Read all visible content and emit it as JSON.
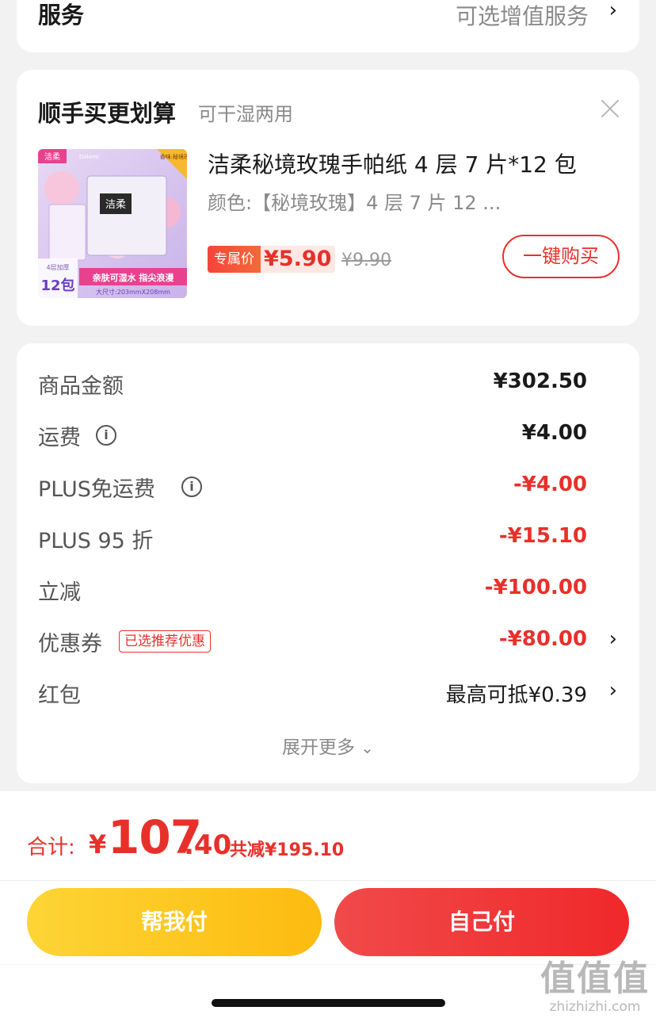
{
  "service": {
    "title": "服务",
    "value": "可选增值服务"
  },
  "upsell": {
    "title": "顺手买更划算",
    "subtitle": "可干湿两用",
    "product": {
      "name": "洁柔秘境玫瑰手帕纸 4 层 7 片*12 包",
      "spec": "颜色:【秘境玫瑰】4 层 7 片 12 ...",
      "exclusive_label": "专属价",
      "price": "¥5.90",
      "original_price": "¥9.90",
      "buy_label": "一键购买",
      "image": {
        "brand": "洁柔",
        "brand_en": "Dolomi",
        "corner_tag": "香味:秘境玫瑰",
        "pack_label": "4层加厚",
        "pack_count": "12包",
        "slogan": "亲肤可湿水 指尖浪漫",
        "size": "大尺寸:203mmX208mm"
      }
    }
  },
  "summary": {
    "rows": [
      {
        "label": "商品金额",
        "value": "¥302.50"
      },
      {
        "label": "运费",
        "value": "¥4.00"
      },
      {
        "label": "PLUS免运费",
        "value": "-¥4.00"
      },
      {
        "label": "PLUS 95 折",
        "value": "-¥15.10"
      },
      {
        "label": "立减",
        "value": "-¥100.00"
      },
      {
        "label": "优惠券",
        "tag": "已选推荐优惠",
        "value": "-¥80.00"
      },
      {
        "label": "红包",
        "value": "最高可抵¥0.39"
      }
    ],
    "expand_label": "展开更多"
  },
  "bottom": {
    "total_label": "合计:",
    "currency": "¥",
    "total_int": "107",
    "total_dec": ".40",
    "saved": "共减¥195.10",
    "help_pay": "帮我付",
    "self_pay": "自己付"
  },
  "watermark": {
    "big": "值值值",
    "small": "zhizhizhi.com"
  },
  "colors": {
    "accent": "#e8302a",
    "yellow": "#fdc520",
    "background": "#f2f2f2"
  }
}
